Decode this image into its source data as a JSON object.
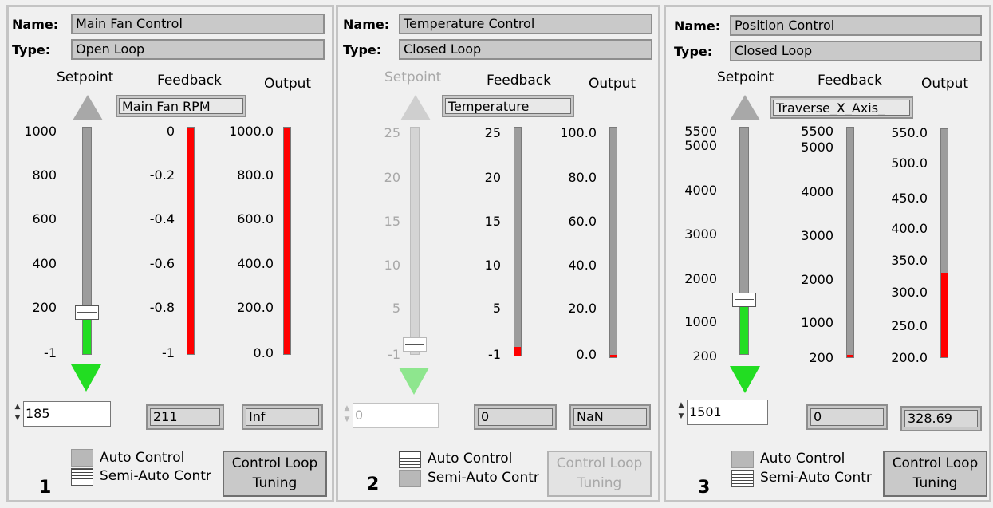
{
  "labels": {
    "name": "Name:",
    "type": "Type:",
    "setpoint": "Setpoint",
    "feedback": "Feedback",
    "output": "Output",
    "auto": "Auto Control",
    "semi": "Semi-Auto Contr",
    "tuning_line1": "Control Loop",
    "tuning_line2": "Tuning"
  },
  "colors": {
    "setpoint_fill": "#22dd22",
    "bar_fill": "#ff0000",
    "panel_bg": "#f0f0f0",
    "track": "#9c9c9c"
  },
  "panels": [
    {
      "number": "1",
      "name": "Main Fan Control",
      "type": "Open Loop",
      "enabled": true,
      "feedback_channel": "Main Fan RPM",
      "setpoint_ticks": [
        "1000",
        "800",
        "600",
        "400",
        "200",
        "-1"
      ],
      "feedback_ticks": [
        "0",
        "-0.2",
        "-0.4",
        "-0.6",
        "-0.8",
        "-1"
      ],
      "output_ticks": [
        "1000.0",
        "800.0",
        "600.0",
        "400.0",
        "200.0",
        "0.0"
      ],
      "setpoint_level": 0.185,
      "feedback_level": 1.0,
      "output_level": 1.0,
      "setpoint_value": "185",
      "feedback_value": "211",
      "output_value": "Inf",
      "control_mode": "semi"
    },
    {
      "number": "2",
      "name": "Temperature Control",
      "type": "Closed Loop",
      "enabled": false,
      "feedback_channel": "Temperature",
      "setpoint_ticks": [
        "25",
        "20",
        "15",
        "10",
        "5",
        "-1"
      ],
      "feedback_ticks": [
        "25",
        "20",
        "15",
        "10",
        "5",
        "-1"
      ],
      "output_ticks": [
        "100.0",
        "80.0",
        "60.0",
        "40.0",
        "20.0",
        "0.0"
      ],
      "setpoint_level": 0.0,
      "feedback_level": 0.04,
      "output_level": 0.01,
      "setpoint_value": "0",
      "feedback_value": "0",
      "output_value": "NaN",
      "control_mode": "auto"
    },
    {
      "number": "3",
      "name": "Position Control",
      "type": "Closed Loop",
      "enabled": true,
      "feedback_channel": "Traverse_X_Axis_",
      "setpoint_ticks": [
        "5500",
        "5000",
        "4000",
        "3000",
        "2000",
        "1000",
        "200"
      ],
      "feedback_ticks": [
        "5500",
        "5000",
        "4000",
        "3000",
        "2000",
        "1000",
        "200"
      ],
      "output_ticks": [
        "550.0",
        "500.0",
        "450.0",
        "400.0",
        "350.0",
        "300.0",
        "250.0",
        "200.0"
      ],
      "setpoint_level": 0.25,
      "feedback_level": 0.01,
      "output_level": 0.37,
      "setpoint_value": "1501",
      "feedback_value": "0",
      "output_value": "328.69",
      "control_mode": "semi"
    }
  ]
}
